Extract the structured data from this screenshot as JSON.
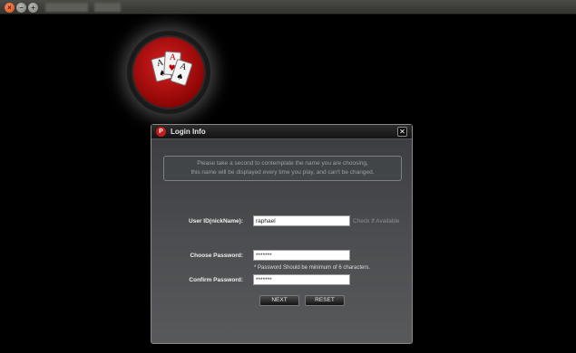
{
  "window": {
    "controls": {
      "close_icon": "×",
      "minimize_icon": "−",
      "maximize_icon": "+"
    }
  },
  "logo": {
    "cards": [
      {
        "rank": "A",
        "suit": "♠"
      },
      {
        "rank": "A",
        "suit": "♥"
      },
      {
        "rank": "A",
        "suit": "♠"
      }
    ]
  },
  "dialog": {
    "title": "Login Info",
    "icon_glyph": "P",
    "close_label": "✕",
    "notice_line1": "Please take a second to contemplate the name you are choosing,",
    "notice_line2": "this name will be displayed every time you play, and can't be changed.",
    "user_id": {
      "label": "User ID(nickName):",
      "value": "raphael",
      "check_link": "Check If Available"
    },
    "password": {
      "label": "Choose Password:",
      "value": "*******"
    },
    "password_hint": "* Password Should be minimum of 6 characters.",
    "confirm_password": {
      "label": "Confirm Password:",
      "value": "*******"
    },
    "buttons": {
      "next": "NEXT",
      "reset": "RESET"
    }
  }
}
